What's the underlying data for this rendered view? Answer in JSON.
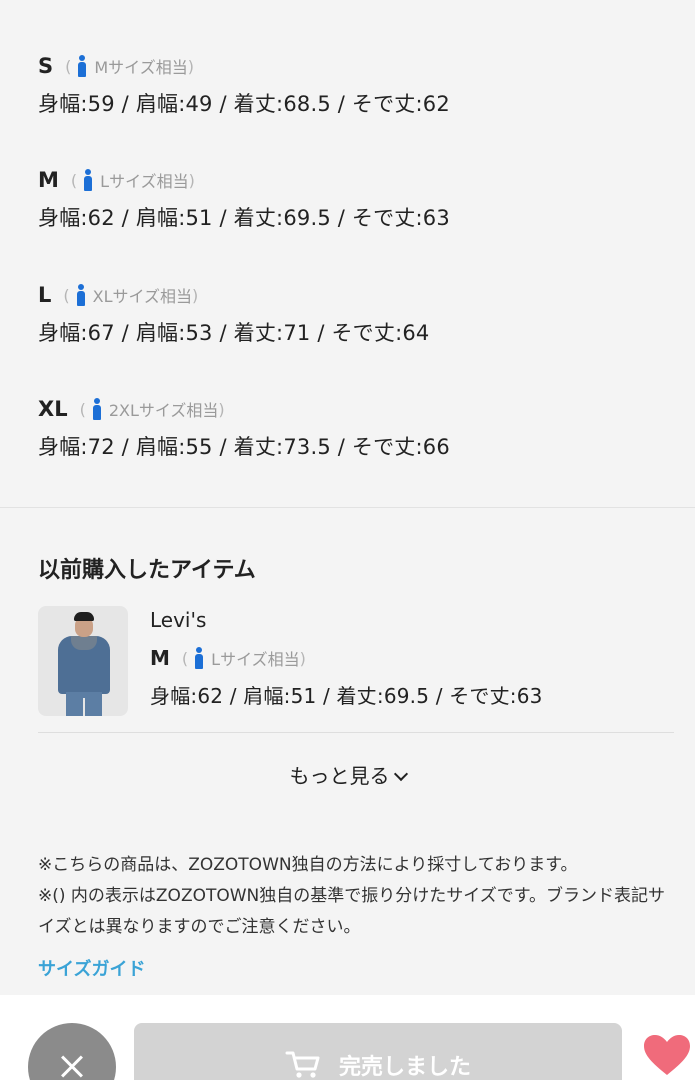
{
  "sizes": [
    {
      "name": "S",
      "open": "(",
      "equiv": "Mサイズ相当",
      "close": ")",
      "measure": "身幅:59 / 肩幅:49 / 着丈:68.5 / そで丈:62"
    },
    {
      "name": "M",
      "open": "(",
      "equiv": "Lサイズ相当",
      "close": ")",
      "measure": "身幅:62 / 肩幅:51 / 着丈:69.5 / そで丈:63"
    },
    {
      "name": "L",
      "open": "(",
      "equiv": "XLサイズ相当",
      "close": ")",
      "measure": "身幅:67 / 肩幅:53 / 着丈:71 / そで丈:64"
    },
    {
      "name": "XL",
      "open": "(",
      "equiv": "2XLサイズ相当",
      "close": ")",
      "measure": "身幅:72 / 肩幅:55 / 着丈:73.5 / そで丈:66"
    }
  ],
  "previous": {
    "title": "以前購入したアイテム",
    "brand": "Levi's",
    "size": "M",
    "open": "(",
    "equiv": "Lサイズ相当",
    "close": ")",
    "measure": "身幅:62 / 肩幅:51 / 着丈:69.5 / そで丈:63"
  },
  "more_label": "もっと見る",
  "notes": [
    "※こちらの商品は、ZOZOTOWN独自の方法により採寸しております。",
    "※() 内の表示はZOZOTOWN独自の基準で振り分けたサイズです。ブランド表記サイズとは異なりますのでご注意ください。"
  ],
  "size_guide": "サイズガイド",
  "soldout_label": "完売しました",
  "colors": {
    "accent_blue": "#1c6fd6",
    "link": "#3aa3d6",
    "heart": "#f06b7b",
    "disabled": "#d3d3d3"
  }
}
